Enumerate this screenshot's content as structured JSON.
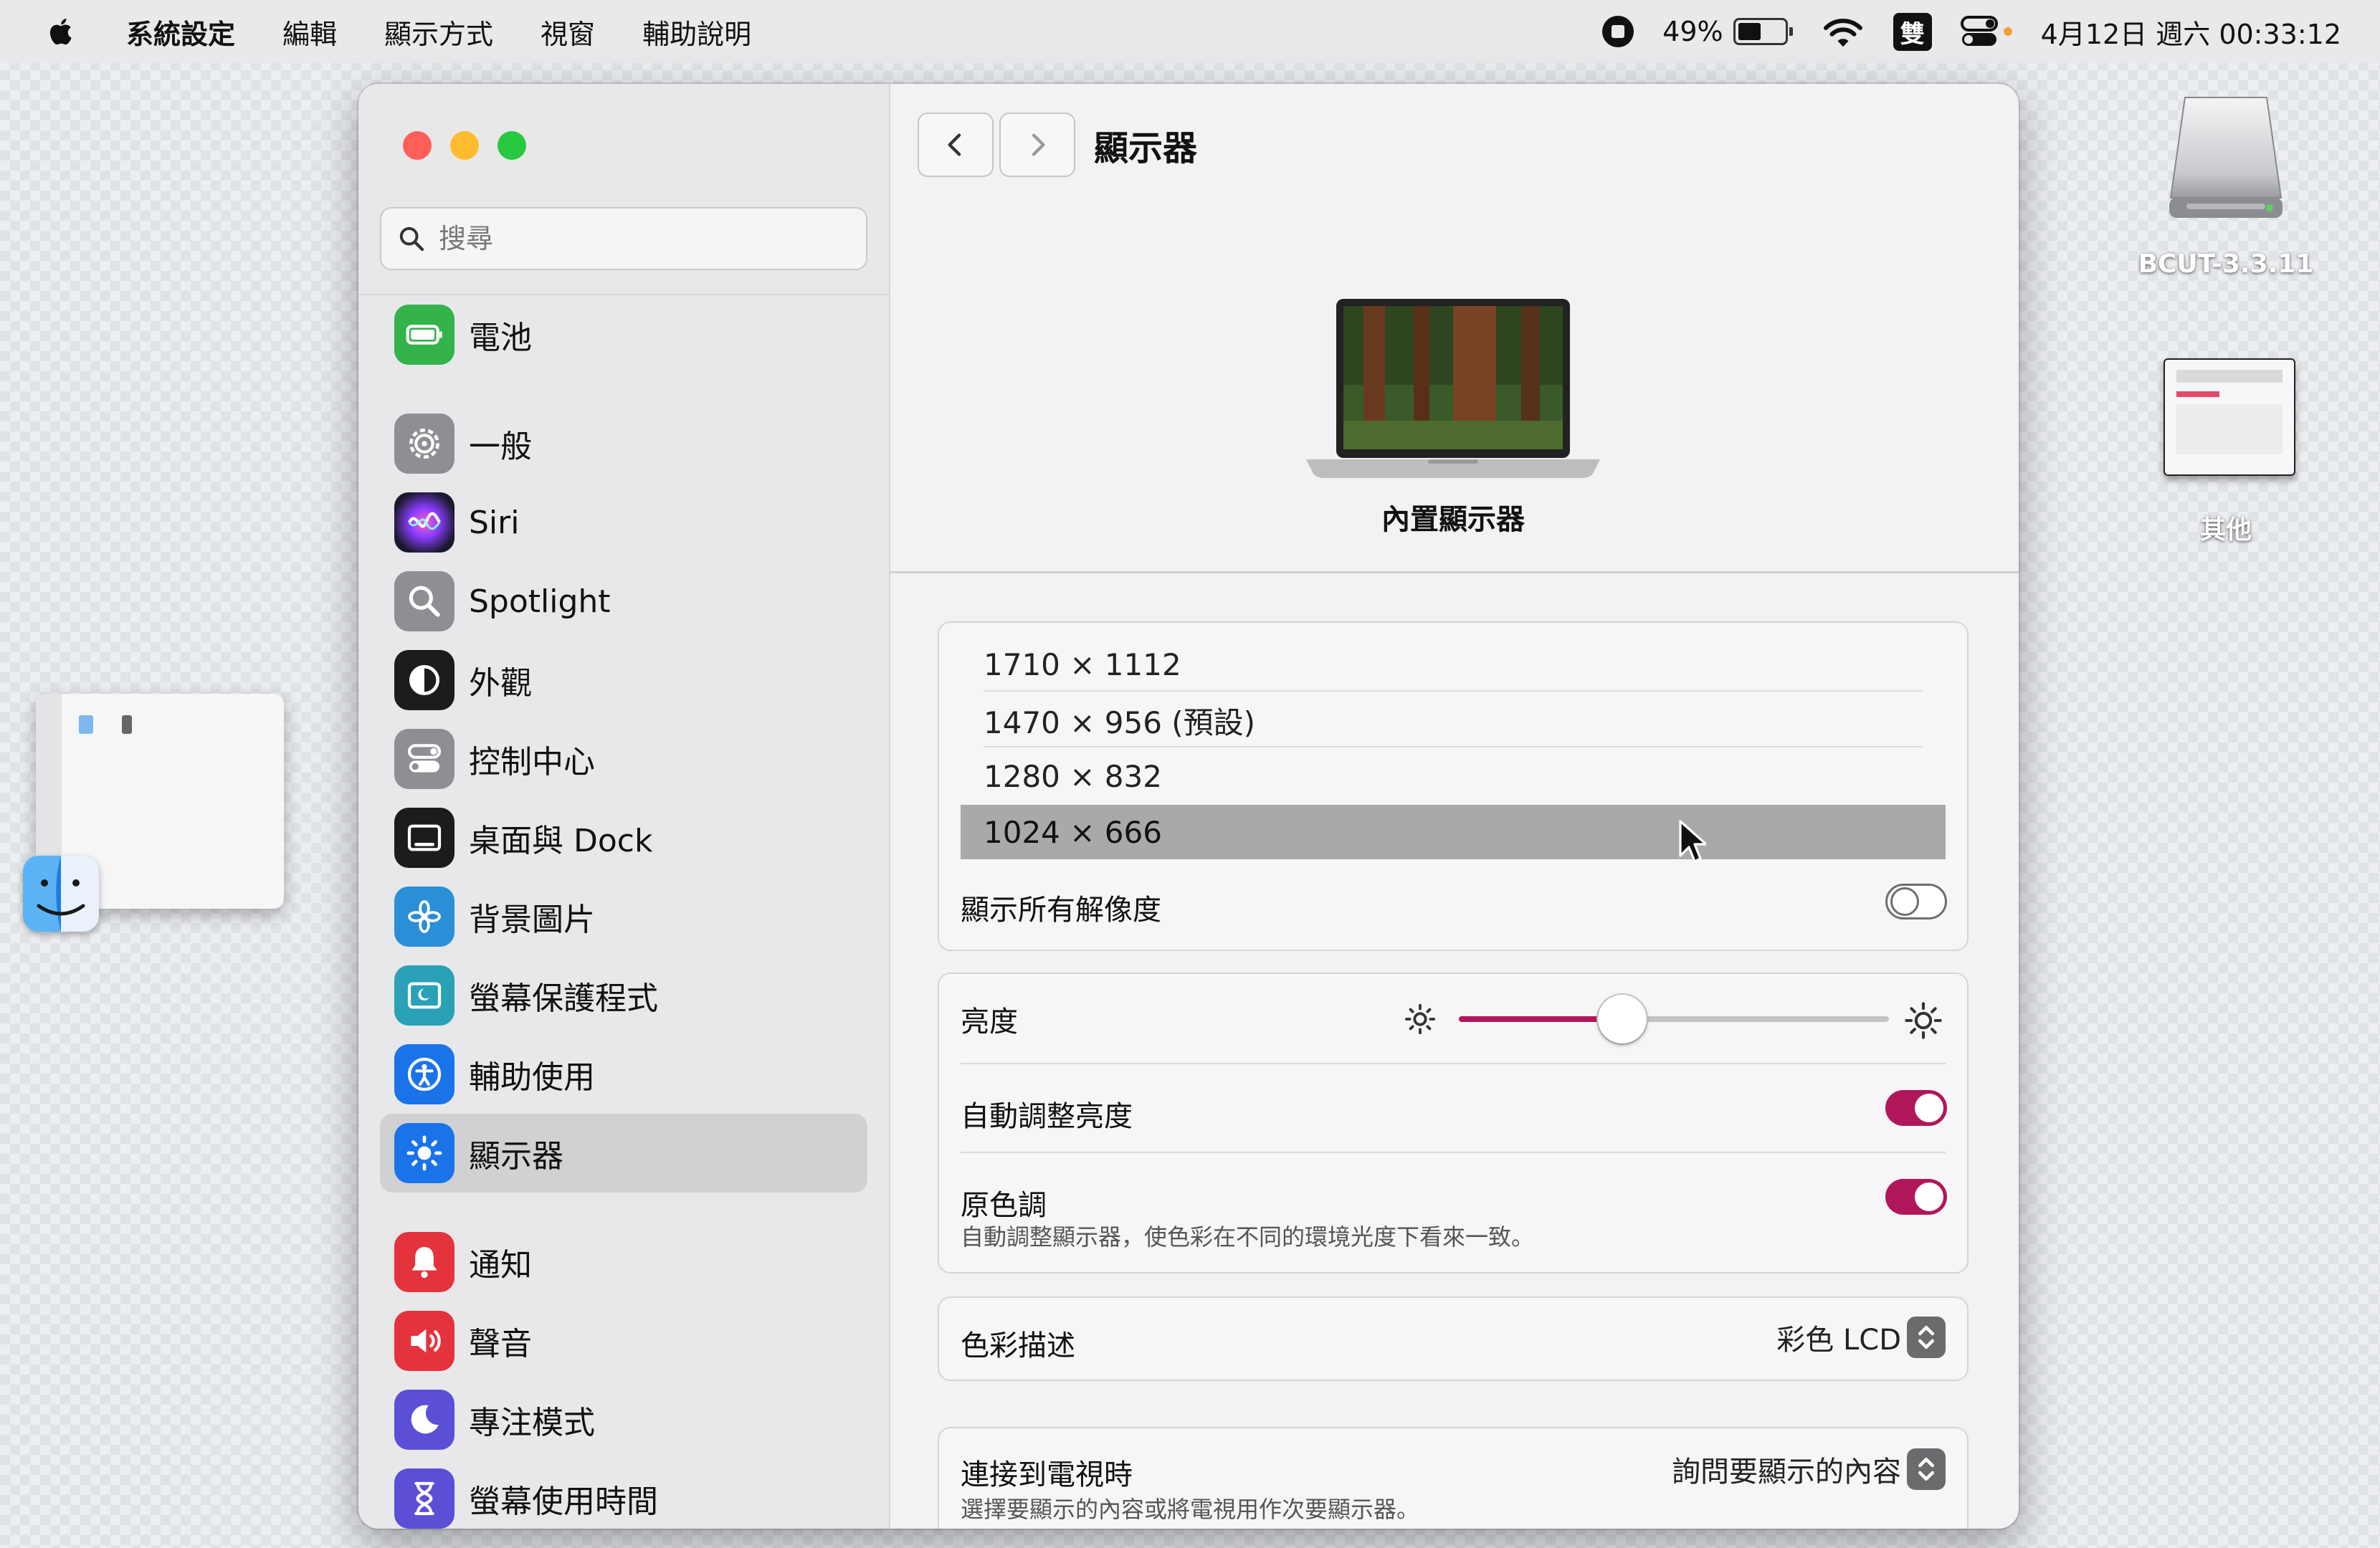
{
  "menubar": {
    "app": "系統設定",
    "items": [
      "編輯",
      "顯示方式",
      "視窗",
      "輔助說明"
    ],
    "battery_percent": "49%",
    "ime": "雙",
    "datetime": "4月12日 週六 00:33:12"
  },
  "desktop": {
    "drive_label": "BCUT-3.3.11",
    "other_label": "其他"
  },
  "sidebar": {
    "search_placeholder": "搜尋",
    "items": [
      {
        "label": "電池",
        "icon": "battery-icon"
      },
      {
        "label": "一般",
        "icon": "gear-icon"
      },
      {
        "label": "Siri",
        "icon": "siri-icon"
      },
      {
        "label": "Spotlight",
        "icon": "spotlight-icon"
      },
      {
        "label": "外觀",
        "icon": "appearance-icon"
      },
      {
        "label": "控制中心",
        "icon": "control-center-icon"
      },
      {
        "label": "桌面與 Dock",
        "icon": "desktop-dock-icon"
      },
      {
        "label": "背景圖片",
        "icon": "wallpaper-icon"
      },
      {
        "label": "螢幕保護程式",
        "icon": "screensaver-icon"
      },
      {
        "label": "輔助使用",
        "icon": "accessibility-icon"
      },
      {
        "label": "顯示器",
        "icon": "displays-icon",
        "selected": true
      },
      {
        "label": "通知",
        "icon": "notifications-icon"
      },
      {
        "label": "聲音",
        "icon": "sound-icon"
      },
      {
        "label": "專注模式",
        "icon": "focus-icon"
      },
      {
        "label": "螢幕使用時間",
        "icon": "screen-time-icon"
      }
    ]
  },
  "main": {
    "title": "顯示器",
    "display_name": "內置顯示器",
    "resolutions": [
      {
        "label": "1710 × 1112",
        "selected": false
      },
      {
        "label": "1470 × 956 (預設)",
        "selected": false
      },
      {
        "label": "1280 × 832",
        "selected": false
      },
      {
        "label": "1024 × 666",
        "selected": true
      }
    ],
    "show_all_label": "顯示所有解像度",
    "show_all_on": false,
    "brightness_label": "亮度",
    "brightness_level": 0.38,
    "auto_brightness_label": "自動調整亮度",
    "auto_brightness_on": true,
    "true_tone_label": "原色調",
    "true_tone_on": true,
    "true_tone_desc": "自動調整顯示器，使色彩在不同的環境光度下看來一致。",
    "color_profile_label": "色彩描述",
    "color_profile_value": "彩色 LCD",
    "tv_label": "連接到電視時",
    "tv_value": "詢問要顯示的內容",
    "tv_desc": "選擇要顯示的內容或將電視用作次要顯示器。"
  },
  "colors": {
    "accent": "#b0165a",
    "selected_row": "#a9a9ac",
    "sidebar_selected": "#d1d1d4"
  }
}
